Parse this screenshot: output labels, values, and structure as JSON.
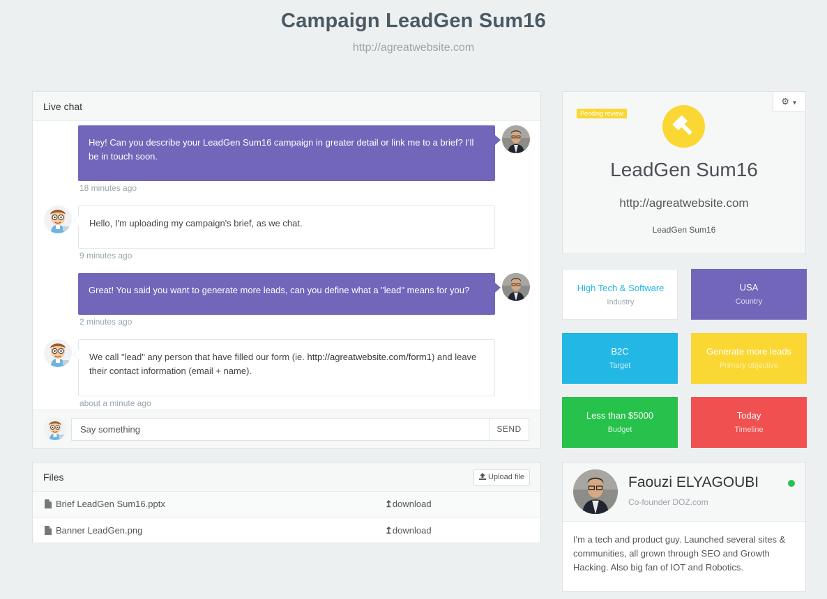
{
  "header": {
    "title": "Campaign LeadGen Sum16",
    "subtitle": "http://agreatwebsite.com"
  },
  "chat": {
    "heading": "Live chat",
    "messages": [
      {
        "direction": "out",
        "text": "Hey! Can you describe your LeadGen Sum16 campaign in greater detail or link me to a brief? I'll be in touch soon.",
        "time": "18 minutes ago"
      },
      {
        "direction": "in",
        "text": "Hello, I'm uploading my campaign's brief, as we chat.",
        "time": "9 minutes ago"
      },
      {
        "direction": "out",
        "text": "Great! You said you want to generate more leads, can you define what a \"lead\" means for you?",
        "time": "2 minutes ago"
      },
      {
        "direction": "in",
        "text_before": "We call \"lead\" any person that have filled our form (ie. ",
        "link": "http://agreatwebsite.com/form1",
        "text_after": ") and leave their contact information (email + name).",
        "time": "about a minute ago"
      }
    ],
    "input_placeholder": "Say something",
    "send_label": "SEND"
  },
  "files": {
    "heading": "Files",
    "upload_label": "Upload file",
    "items": [
      {
        "name": "Brief LeadGen Sum16.pptx",
        "download_label": "download"
      },
      {
        "name": "Banner LeadGen.png",
        "download_label": "download"
      }
    ]
  },
  "campaign": {
    "badge": "Pending review",
    "icon": "gavel-icon",
    "title": "LeadGen Sum16",
    "url": "http://agreatwebsite.com",
    "name": "LeadGen Sum16",
    "settings_icon": "gear-icon"
  },
  "tiles": [
    {
      "value": "High Tech & Software",
      "label": "Industry",
      "bg": "#ffffff",
      "value_color": "#23b7e5",
      "label_color": "#98a6ad"
    },
    {
      "value": "USA",
      "label": "Country",
      "bg": "#7266ba",
      "value_color": "#ffffff",
      "label_color": "#dcd8f0"
    },
    {
      "value": "B2C",
      "label": "Target",
      "bg": "#23b7e5",
      "value_color": "#ffffff",
      "label_color": "#d4f0fa"
    },
    {
      "value": "Generate more leads",
      "label": "Primary objective",
      "bg": "#fad733",
      "value_color": "#ffffff",
      "label_color": "#fdf0a8"
    },
    {
      "value": "Less than $5000",
      "label": "Budget",
      "bg": "#27c24c",
      "value_color": "#ffffff",
      "label_color": "#d0f2d9"
    },
    {
      "value": "Today",
      "label": "Timeline",
      "bg": "#f05050",
      "value_color": "#ffffff",
      "label_color": "#fdd8d8"
    }
  ],
  "profile": {
    "name": "Faouzi ELYAGOUBI",
    "role": "Co-founder DOZ.com",
    "status": "online",
    "bio": "I'm a tech and product guy. Launched several sites & communities, all grown through SEO and Growth Hacking. Also big fan of IOT and Robotics."
  }
}
